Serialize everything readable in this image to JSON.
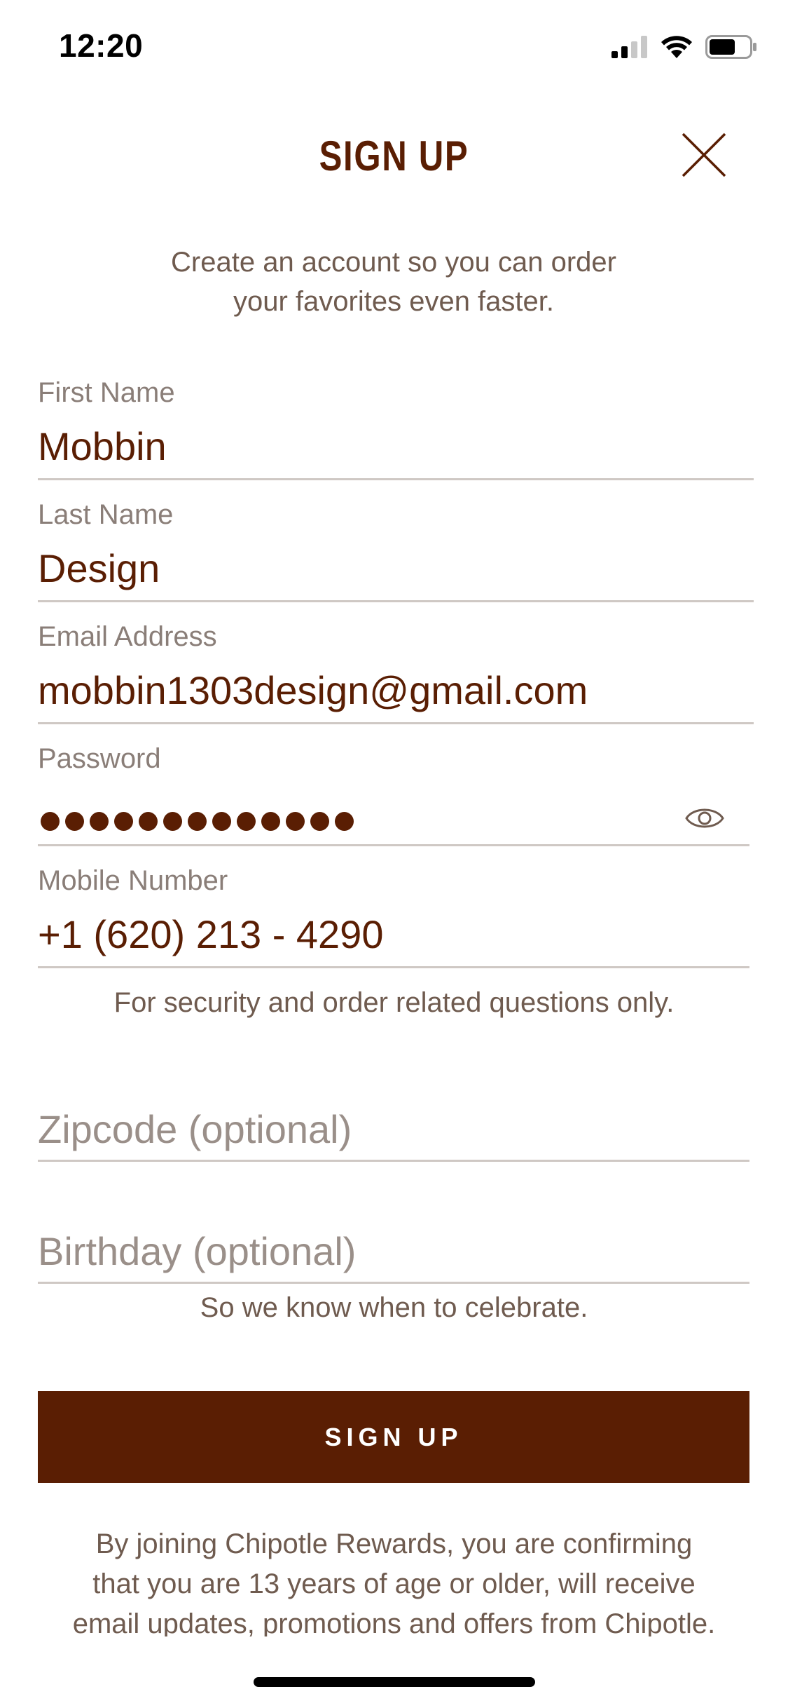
{
  "status_bar": {
    "time": "12:20"
  },
  "header": {
    "title": "SIGN UP"
  },
  "intro": {
    "line1": "Create an account so you can order",
    "line2": "your favorites even faster."
  },
  "fields": {
    "first_name": {
      "label": "First Name",
      "value": "Mobbin"
    },
    "last_name": {
      "label": "Last Name",
      "value": "Design"
    },
    "email": {
      "label": "Email Address",
      "value": "mobbin1303design@gmail.com"
    },
    "password": {
      "label": "Password",
      "masked_length": 13
    },
    "mobile": {
      "label": "Mobile Number",
      "value": "+1 (620) 213 - 4290",
      "hint": "For security and order related questions only."
    },
    "zipcode": {
      "placeholder": "Zipcode (optional)"
    },
    "birthday": {
      "placeholder": "Birthday (optional)",
      "hint": "So we know when to celebrate."
    }
  },
  "signup_button": {
    "label": "SIGN UP"
  },
  "legal": {
    "line1": "By joining Chipotle Rewards, you are confirming",
    "line2": "that you are 13 years of age or older, will receive",
    "line3": "email updates, promotions and offers from Chipotle."
  },
  "icons": {
    "close": "close-icon",
    "eye": "eye-icon",
    "signal": "cellular-signal-icon",
    "wifi": "wifi-icon",
    "battery": "battery-icon"
  },
  "colors": {
    "brand": "#5a1e03",
    "muted_text": "#6f5b4f",
    "label_text": "#8a7e78",
    "divider": "#cfc8c4"
  }
}
